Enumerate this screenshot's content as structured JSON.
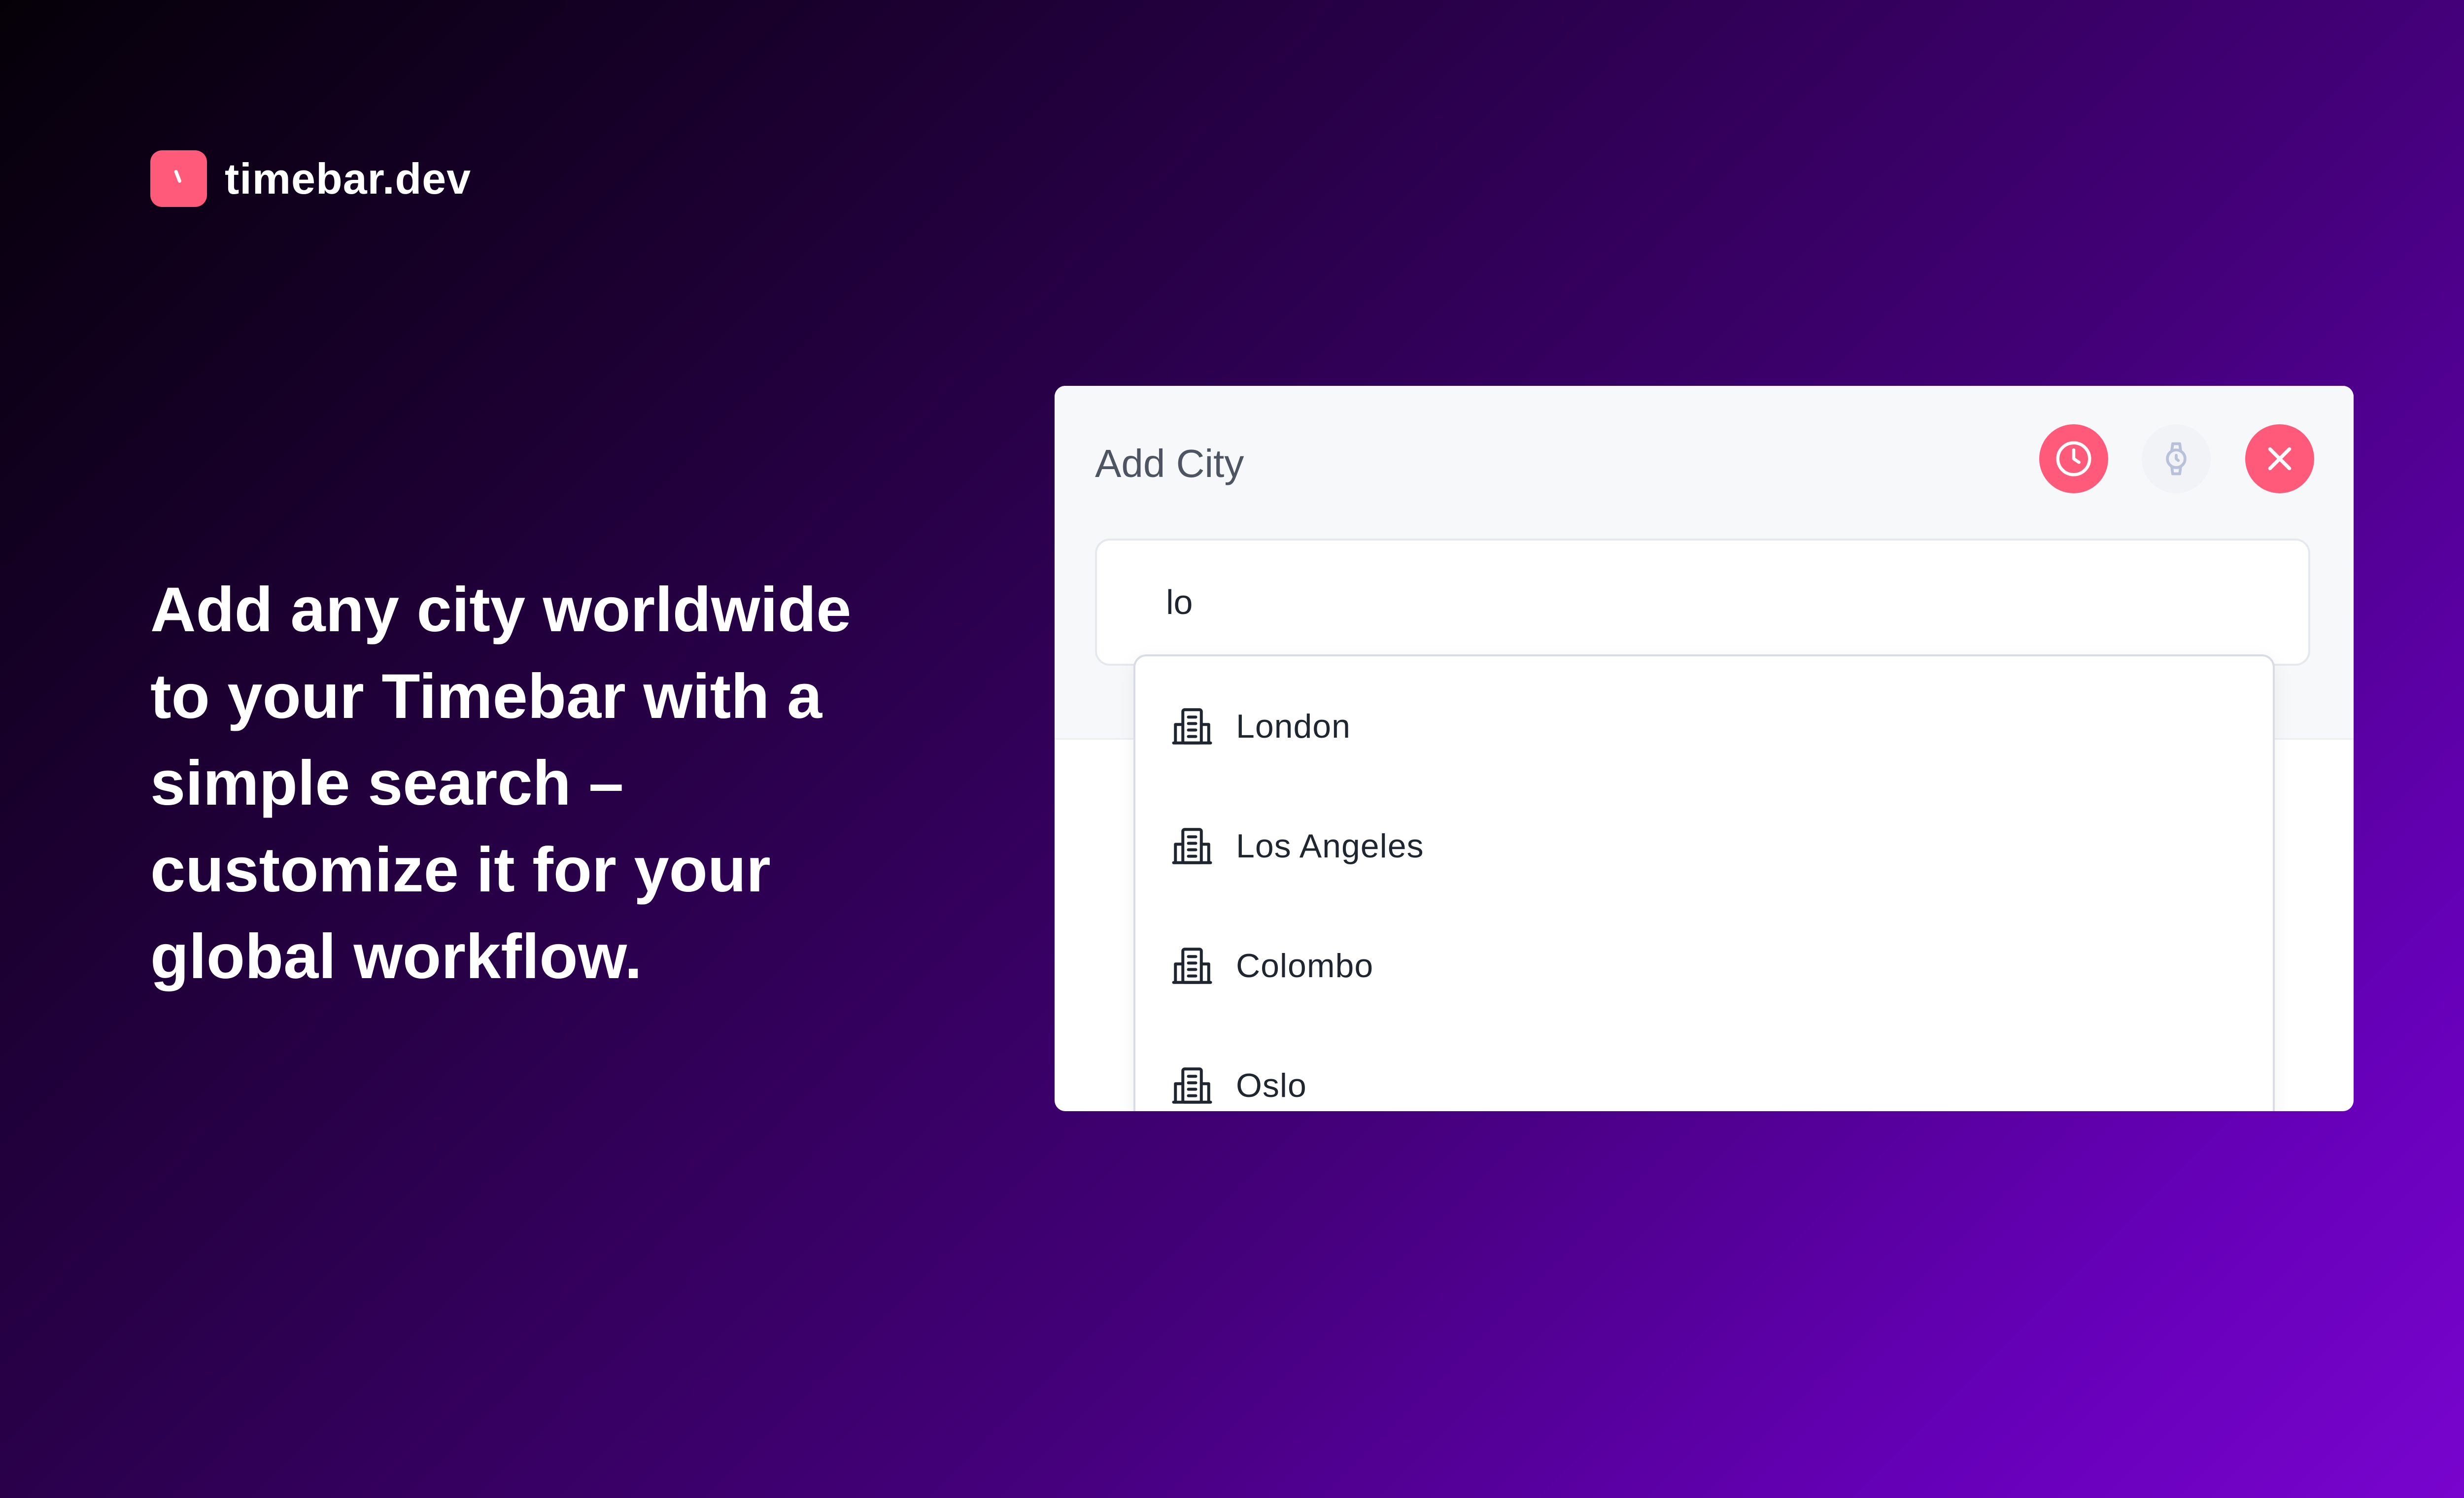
{
  "brand": {
    "name": "timebar.dev",
    "accent_color": "#ff5a7a",
    "logo_icon": "clock-icon"
  },
  "headline": {
    "lines": [
      "Add any city worldwide",
      "to your Timebar with a",
      "simple search –",
      "customize it for your",
      "global workflow."
    ]
  },
  "card": {
    "title": "Add City",
    "actions": [
      {
        "name": "clock-icon",
        "color": "#ff5a7a"
      },
      {
        "name": "watch-icon",
        "color": "#f1f3f6"
      },
      {
        "name": "close-icon",
        "color": "#ff5a7a"
      }
    ],
    "search": {
      "value": "lo",
      "placeholder": ""
    },
    "results": [
      {
        "label": "London",
        "icon": "building-icon"
      },
      {
        "label": "Los Angeles",
        "icon": "building-icon"
      },
      {
        "label": "Colombo",
        "icon": "building-icon"
      },
      {
        "label": "Oslo",
        "icon": "building-icon"
      }
    ]
  }
}
